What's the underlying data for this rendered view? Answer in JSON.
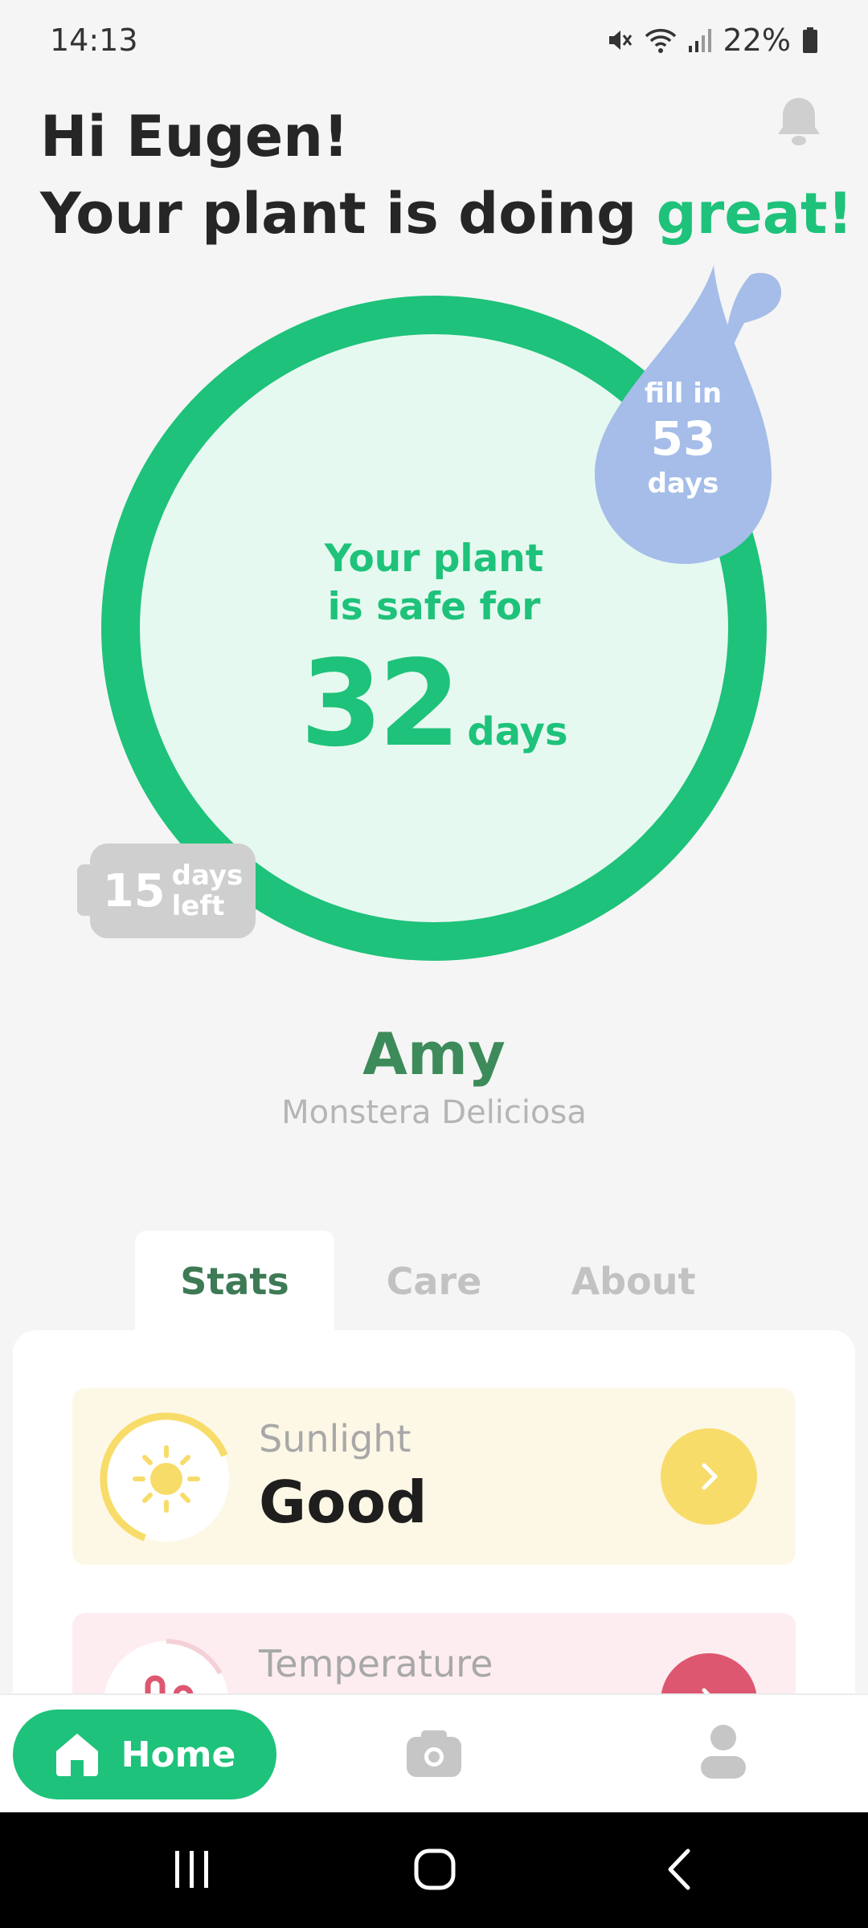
{
  "status": {
    "time": "14:13",
    "battery": "22%"
  },
  "greeting": {
    "line1": "Hi Eugen!",
    "line2_prefix": "Your plant is doing ",
    "line2_accent": "great!"
  },
  "safe": {
    "line1": "Your plant",
    "line2": "is safe for",
    "days": "32",
    "unit": "days"
  },
  "refill": {
    "label": "fill in",
    "days": "53",
    "unit": "days"
  },
  "countdown": {
    "days": "15",
    "label_line1": "days",
    "label_line2": "left"
  },
  "plant": {
    "name": "Amy",
    "species": "Monstera Deliciosa"
  },
  "tabs": [
    {
      "label": "Stats",
      "active": true
    },
    {
      "label": "Care",
      "active": false
    },
    {
      "label": "About",
      "active": false
    }
  ],
  "stats": [
    {
      "label": "Sunlight",
      "value": "Good",
      "color": "#f8dc6a"
    },
    {
      "label": "Temperature",
      "value": "",
      "color": "#dd5770"
    }
  ],
  "nav": {
    "home_label": "Home"
  },
  "colors": {
    "accent": "#1ec27a",
    "water": "#a5bde8",
    "dark_green": "#3d7a55"
  }
}
